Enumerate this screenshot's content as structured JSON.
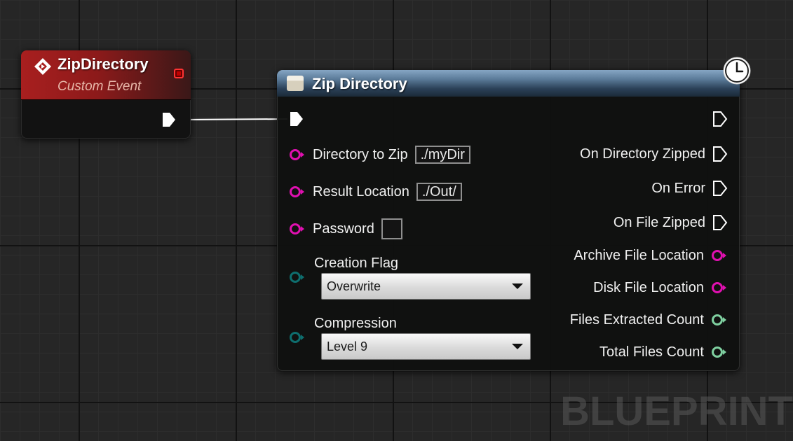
{
  "event_node": {
    "title": "ZipDirectory",
    "subtitle": "Custom Event",
    "icon": "event-diamond-icon",
    "accent": "#a81f1f"
  },
  "function_node": {
    "title": "Zip Directory",
    "icon": "function-node-icon",
    "latent_icon": "clock-icon",
    "accent": "#5a7a98",
    "inputs": {
      "directory_to_zip": {
        "label": "Directory to Zip",
        "value": "./myDir"
      },
      "result_location": {
        "label": "Result Location",
        "value": "./Out/"
      },
      "password": {
        "label": "Password",
        "value": ""
      },
      "creation_flag": {
        "label": "Creation Flag",
        "selected": "Overwrite"
      },
      "compression": {
        "label": "Compression",
        "selected": "Level 9"
      }
    },
    "outputs": {
      "on_directory_zipped": "On Directory Zipped",
      "on_error": "On Error",
      "on_file_zipped": "On File Zipped",
      "archive_file_location": "Archive File Location",
      "disk_file_location": "Disk File Location",
      "files_extracted_count": "Files Extracted Count",
      "total_files_count": "Total Files Count"
    }
  },
  "pin_colors": {
    "string": "#e010b0",
    "byte": "#0e6e6e",
    "integer": "#7fd0a0",
    "exec": "#ffffff"
  },
  "watermark": "BLUEPRINT"
}
